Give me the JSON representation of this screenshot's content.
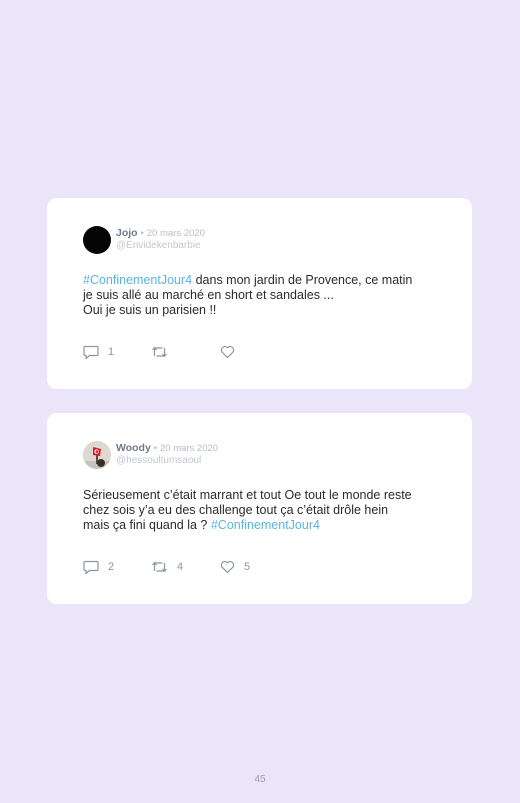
{
  "tweets": [
    {
      "author": "Jojo",
      "separator": "•",
      "date": "20 mars 2020",
      "handle": "@Envidekenbarbie",
      "text": {
        "hashtag_start": "#ConfinementJour4",
        "line1_rest": " dans mon jardin de Provence, ce matin",
        "line2": "je suis allé au marché en short et sandales ...",
        "line3": "Oui je suis un parisien !!"
      },
      "replies": "1",
      "retweets": "",
      "likes": ""
    },
    {
      "author": "Woody",
      "separator": "•",
      "date": "20 mars 2020",
      "handle": "@hessoultumsaoul",
      "text": {
        "line1": "Sérieusement c’était marrant et tout Oe tout le monde reste",
        "line2": "chez sois y’a eu des challenge tout ça c’était drôle hein",
        "line3_start": "mais ça fini quand la ? ",
        "hashtag_end": "#ConfinementJour4"
      },
      "replies": "2",
      "retweets": "4",
      "likes": "5"
    }
  ],
  "icons": {
    "reply": "comment-bubble-icon",
    "retweet": "retweet-icon",
    "like": "heart-icon"
  },
  "colors": {
    "background": "#ebe5f9",
    "card": "#ffffff",
    "hashtag": "#5ab4e0",
    "author": "#6e7a8d",
    "icon": "#8c95a3"
  },
  "page_number": "45"
}
